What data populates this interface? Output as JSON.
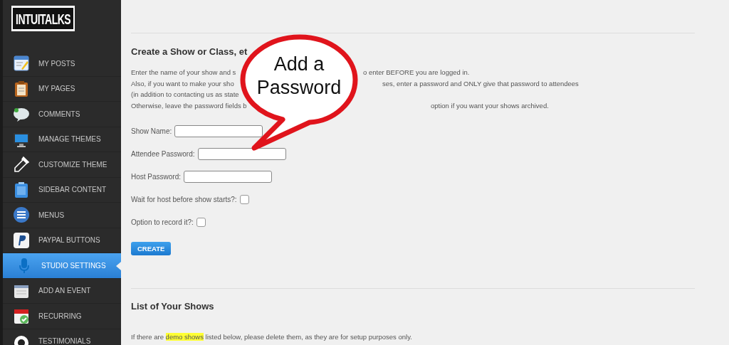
{
  "sidebar": {
    "logo": "INTUITALKS",
    "items": [
      {
        "label": "MY POSTS",
        "selected": false
      },
      {
        "label": "MY PAGES",
        "selected": false
      },
      {
        "label": "COMMENTS",
        "selected": false
      },
      {
        "label": "MANAGE THEMES",
        "selected": false
      },
      {
        "label": "CUSTOMIZE THEME",
        "selected": false
      },
      {
        "label": "SIDEBAR CONTENT",
        "selected": false
      },
      {
        "label": "MENUS",
        "selected": false
      },
      {
        "label": "PAYPAL BUTTONS",
        "selected": false
      },
      {
        "label": "STUDIO SETTINGS",
        "selected": true
      },
      {
        "label": "ADD AN EVENT",
        "selected": false
      },
      {
        "label": "RECURRING",
        "selected": false
      },
      {
        "label": "TESTIMONIALS",
        "selected": false
      }
    ]
  },
  "create_section": {
    "heading": "Create a Show or Class, et",
    "intro_lines": [
      {
        "left": "Enter the name of your show and s",
        "right": "o enter BEFORE you are logged in."
      },
      {
        "left": "Also, if you want to make your sho",
        "right": "ses, enter a password and ONLY give that password to attendees"
      },
      {
        "left": "(in addition to contacting us as state"
      },
      {
        "left": "Otherwise, leave the password fields b",
        "right": "option if you want your shows archived."
      }
    ],
    "fields": [
      {
        "kind": "text",
        "label": "Show Name:"
      },
      {
        "kind": "text",
        "label": "Attendee Password:"
      },
      {
        "kind": "text",
        "label": "Host Password:"
      },
      {
        "kind": "checkbox",
        "label": "Wait for host before show starts?:",
        "checked": false
      },
      {
        "kind": "checkbox",
        "label": "Option to record it?:",
        "checked": false
      }
    ],
    "button": "CREATE"
  },
  "callout": {
    "lines": [
      "Add a",
      "Password"
    ]
  },
  "list_section": {
    "heading": "List of Your Shows",
    "note_before": "If there are ",
    "note_highlight": "demo shows",
    "note_after": " listed below, please delete them, as they are for setup purposes only."
  }
}
